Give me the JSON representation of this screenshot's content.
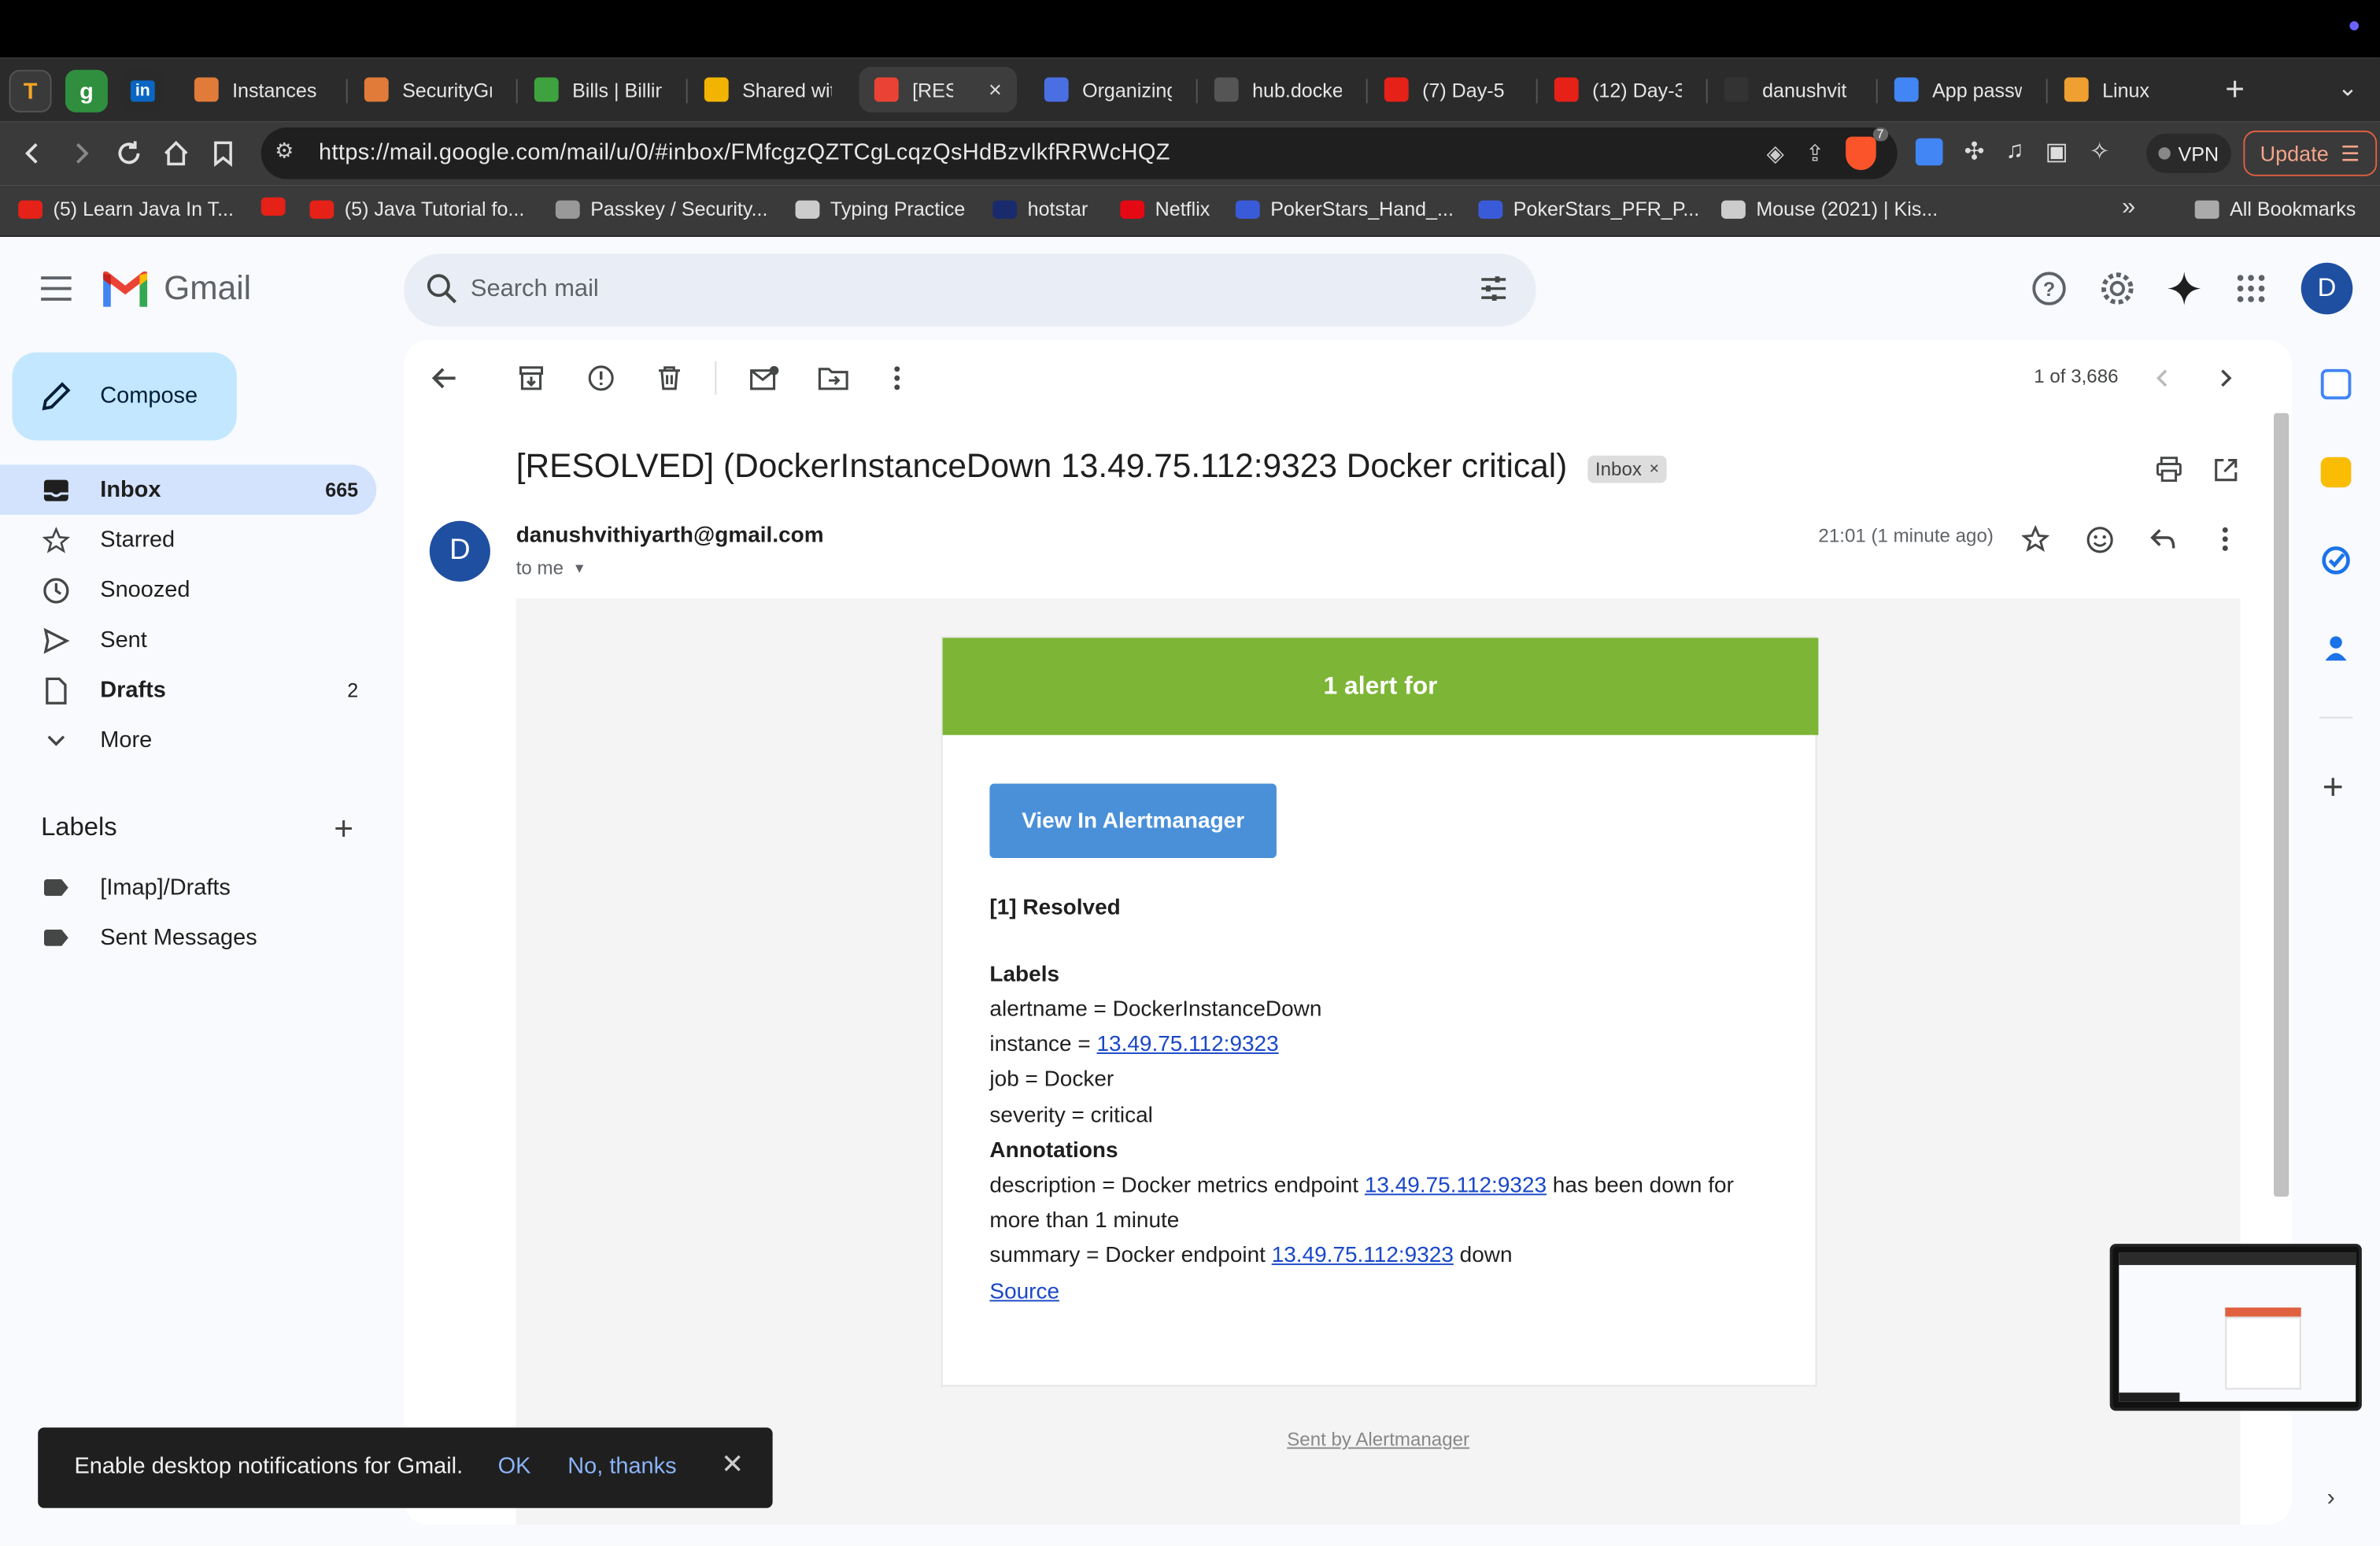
{
  "browser": {
    "tabs": [
      {
        "title": "Instances",
        "fav_color": "#e07b39"
      },
      {
        "title": "SecurityGr",
        "fav_color": "#e07b39"
      },
      {
        "title": "Bills | Billin",
        "fav_color": "#3ea33e"
      },
      {
        "title": "Shared wit",
        "fav_color": "#f2b400"
      },
      {
        "title": "[RESO",
        "fav_color": "#ea4335",
        "active": true
      },
      {
        "title": "Organizing",
        "fav_color": "#4a6fe3"
      },
      {
        "title": "hub.docke",
        "fav_color": "#555"
      },
      {
        "title": "(7) Day-5",
        "fav_color": "#e62117"
      },
      {
        "title": "(12) Day-3",
        "fav_color": "#e62117"
      },
      {
        "title": "danushvit",
        "fav_color": "#333"
      },
      {
        "title": "App passw",
        "fav_color": "#4285f4"
      },
      {
        "title": "Linux",
        "fav_color": "#f0a030"
      }
    ],
    "url": "https://mail.google.com/mail/u/0/#inbox/FMfcgzQZTCgLcqzQsHdBzvlkfRRWcHQZ",
    "brave_badge": "7",
    "vpn_label": "VPN",
    "update_label": "Update",
    "bookmarks": [
      {
        "label": "(5) Learn Java In T...",
        "color": "#e62117"
      },
      {
        "label": "",
        "color": "#e62117"
      },
      {
        "label": "(5) Java Tutorial fo...",
        "color": "#e62117"
      },
      {
        "label": "Passkey / Security...",
        "color": "#999"
      },
      {
        "label": "Typing Practice",
        "color": "#ccc"
      },
      {
        "label": "hotstar",
        "color": "#1a2b6d"
      },
      {
        "label": "Netflix",
        "color": "#e50914"
      },
      {
        "label": "PokerStars_Hand_...",
        "color": "#3a5bd9"
      },
      {
        "label": "PokerStars_PFR_P...",
        "color": "#3a5bd9"
      },
      {
        "label": "Mouse (2021) | Kis...",
        "color": "#ccc"
      }
    ],
    "all_bookmarks": "All Bookmarks"
  },
  "gmail": {
    "logo_text": "Gmail",
    "search_placeholder": "Search mail",
    "avatar_letter": "D",
    "compose_label": "Compose",
    "nav": [
      {
        "label": "Inbox",
        "count": "665",
        "selected": true,
        "bold": true
      },
      {
        "label": "Starred",
        "count": ""
      },
      {
        "label": "Snoozed",
        "count": ""
      },
      {
        "label": "Sent",
        "count": ""
      },
      {
        "label": "Drafts",
        "count": "2",
        "bold": true
      },
      {
        "label": "More",
        "count": ""
      }
    ],
    "labels_heading": "Labels",
    "labels": [
      "[Imap]/Drafts",
      "Sent Messages"
    ]
  },
  "email": {
    "pager": "1 of 3,686",
    "subject": "[RESOLVED] (DockerInstanceDown 13.49.75.112:9323 Docker critical)",
    "inbox_chip": "Inbox",
    "sender_letter": "D",
    "sender": "danushvithiyarth@gmail.com",
    "to": "to me",
    "time": "21:01 (1 minute ago)",
    "body": {
      "header": "1 alert for",
      "button": "View In Alertmanager",
      "resolved": "[1] Resolved",
      "labels_title": "Labels",
      "alertname": "alertname = DockerInstanceDown",
      "instance_prefix": "instance = ",
      "instance": "13.49.75.112:9323",
      "job": "job = Docker",
      "severity": "severity = critical",
      "annotations_title": "Annotations",
      "description_prefix": "description = Docker metrics endpoint ",
      "description_link": "13.49.75.112:9323",
      "description_suffix": " has been down for",
      "description_cont": "more than 1 minute",
      "summary_prefix": "summary = Docker endpoint ",
      "summary_link": "13.49.75.112:9323",
      "summary_suffix": " down",
      "source": "Source",
      "sent_by": "Sent by Alertmanager"
    }
  },
  "toast": {
    "message": "Enable desktop notifications for Gmail.",
    "ok": "OK",
    "no": "No, thanks"
  },
  "colors": {
    "alert_header": "#7db536",
    "alert_button": "#4a90d9",
    "link": "#1a47c7",
    "selected_nav": "#d3e3fd",
    "compose_bg": "#c2e7ff"
  }
}
